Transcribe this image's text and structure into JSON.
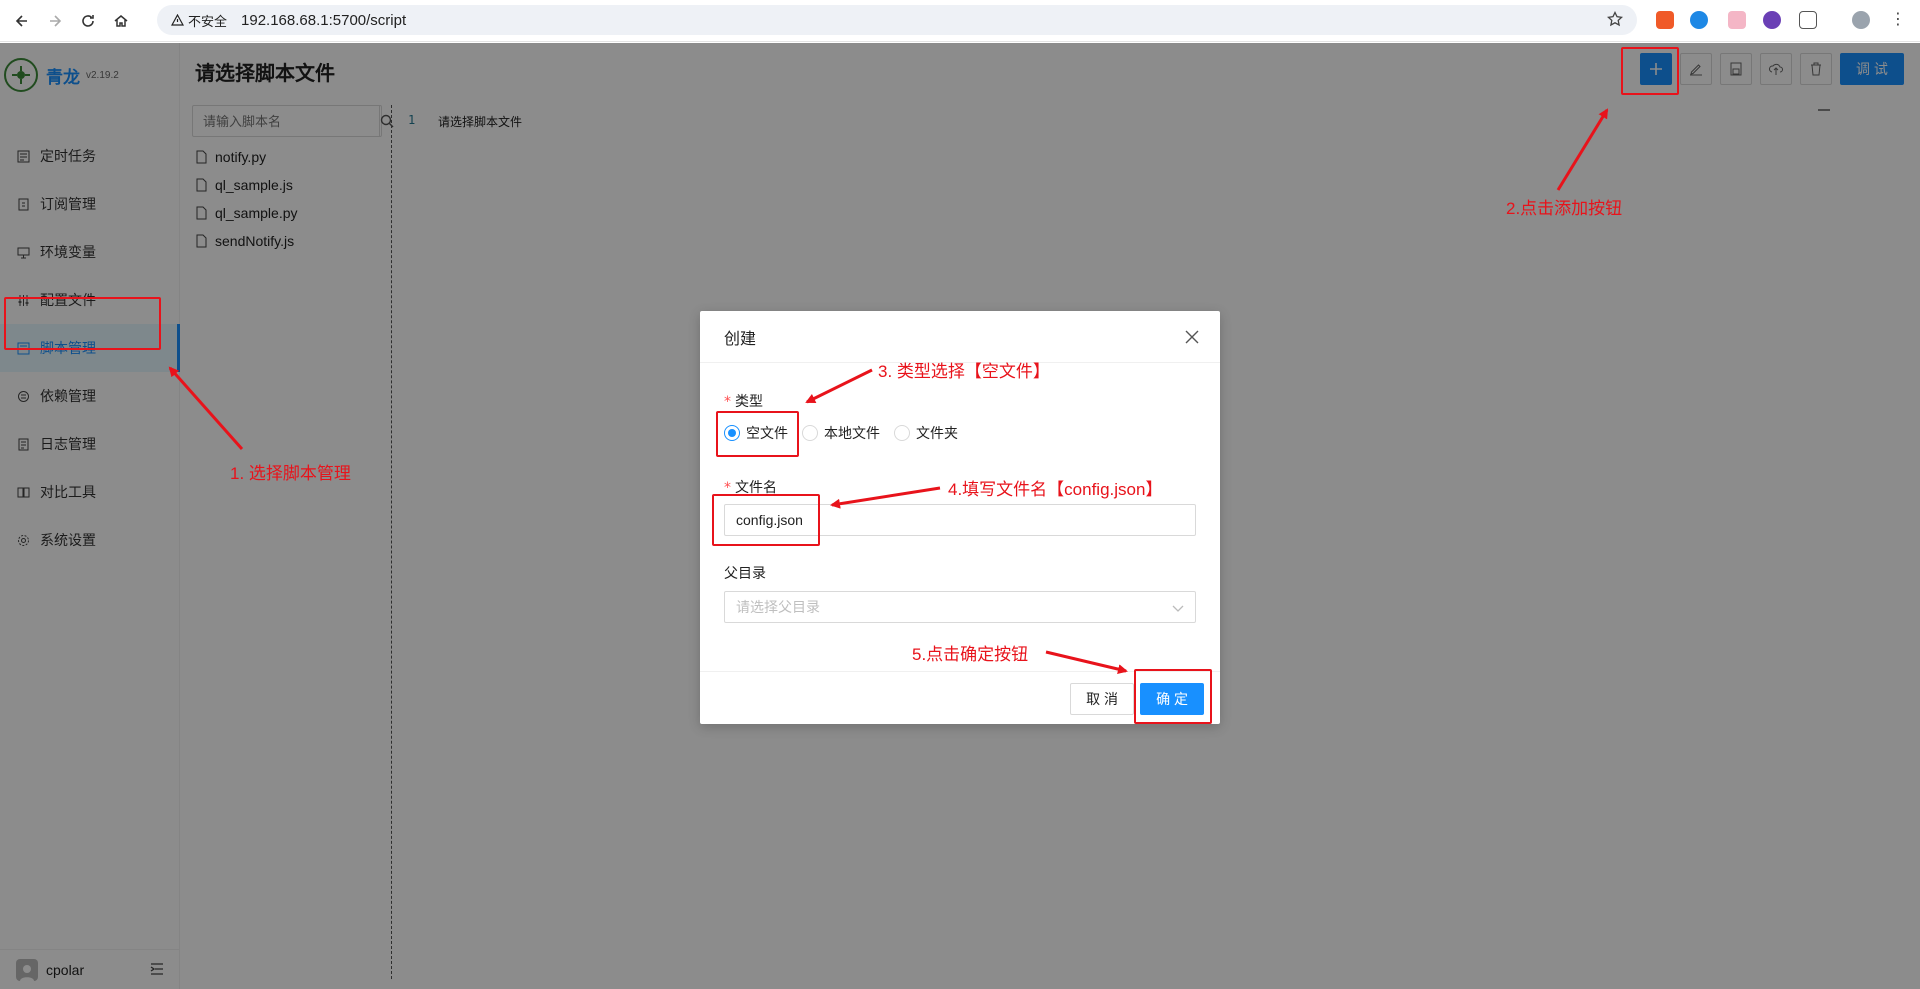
{
  "browser": {
    "security_label": "不安全",
    "url": "192.168.68.1:5700/script"
  },
  "app": {
    "name": "青龙",
    "version": "v2.19.2"
  },
  "sidebar": {
    "items": [
      {
        "label": "定时任务",
        "icon": "clock-list-icon"
      },
      {
        "label": "订阅管理",
        "icon": "subscription-icon"
      },
      {
        "label": "环境变量",
        "icon": "monitor-icon"
      },
      {
        "label": "配置文件",
        "icon": "sliders-icon"
      },
      {
        "label": "脚本管理",
        "icon": "script-icon"
      },
      {
        "label": "依赖管理",
        "icon": "dependency-icon"
      },
      {
        "label": "日志管理",
        "icon": "log-icon"
      },
      {
        "label": "对比工具",
        "icon": "diff-icon"
      },
      {
        "label": "系统设置",
        "icon": "gear-icon"
      }
    ],
    "active_index": 4,
    "user": "cpolar"
  },
  "main": {
    "title": "请选择脚本文件",
    "toolbar": {
      "debug_label": "调 试"
    },
    "search_placeholder": "请输入脚本名",
    "files": [
      "notify.py",
      "ql_sample.js",
      "ql_sample.py",
      "sendNotify.js"
    ],
    "editor": {
      "line_number": "1",
      "line_text": "请选择脚本文件"
    }
  },
  "modal": {
    "title": "创建",
    "type_label": "类型",
    "type_options": [
      "空文件",
      "本地文件",
      "文件夹"
    ],
    "type_selected": 0,
    "filename_label": "文件名",
    "filename_value": "config.json",
    "parent_label": "父目录",
    "parent_placeholder": "请选择父目录",
    "cancel_label": "取 消",
    "ok_label": "确 定"
  },
  "annotations": {
    "step1": "1. 选择脚本管理",
    "step2": "2.点击添加按钮",
    "step3": "3. 类型选择【空文件】",
    "step4": "4.填写文件名【config.json】",
    "step5": "5.点击确定按钮",
    "color": "#e8131b"
  },
  "colors": {
    "primary": "#1890ff",
    "overlay": "rgba(0,0,0,0.45)",
    "annotation": "#e8131b"
  }
}
